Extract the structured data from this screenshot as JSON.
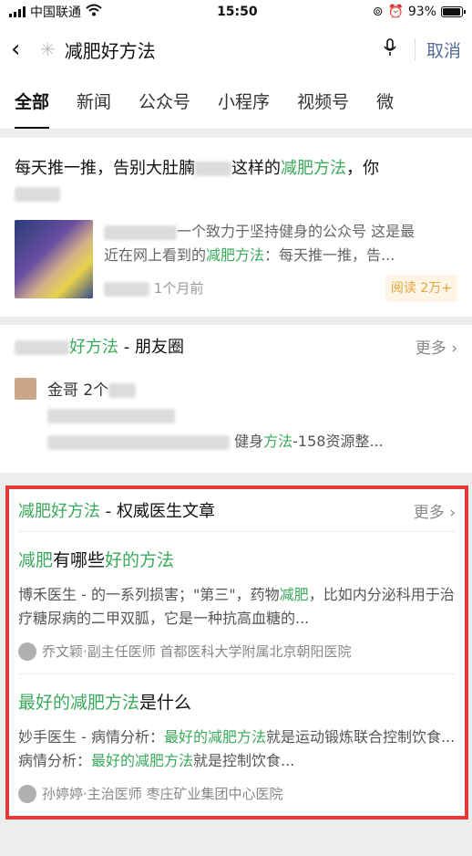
{
  "status": {
    "carrier": "中国联通",
    "time": "15:50",
    "battery": "93%",
    "battery_level": 0.93
  },
  "search": {
    "query": "减肥好方法",
    "cancel": "取消"
  },
  "tabs": [
    "全部",
    "新闻",
    "公众号",
    "小程序",
    "视频号",
    "微"
  ],
  "article": {
    "title_pre": "每天推一推，告别大肚腩",
    "title_mid": "这样的",
    "title_hl": "减肥方法",
    "title_post": "，你",
    "desc_pre": "一个致力于坚持健身的公众号 这是最",
    "desc_mid": "近在网上看到的",
    "desc_hl": "减肥方法",
    "desc_post": "：每天推一推，告...",
    "time": "1个月前",
    "reads": "阅读 2万+"
  },
  "moments": {
    "title_hl": "好方法",
    "title_post": " - 朋友圈",
    "more": "更多",
    "name": "金哥",
    "count": "2个",
    "link_pre": "健身",
    "link_hl": "方法",
    "link_post": "-158资源整..."
  },
  "doctor": {
    "title_hl": "减肥好方法",
    "title_post": " - 权威医生文章",
    "more": "更多",
    "items": [
      {
        "q_parts": [
          {
            "t": "减肥",
            "g": true
          },
          {
            "t": "有哪些",
            "g": false
          },
          {
            "t": "好的方法",
            "g": true
          }
        ],
        "snip_parts": [
          {
            "t": "博禾医生 - 的一系列损害；\"第三\"，药物",
            "g": false
          },
          {
            "t": "减肥",
            "g": true
          },
          {
            "t": "，比如内分泌科用于治疗糖尿病的二甲双胍，它是一种抗高血糖的...",
            "g": false
          }
        ],
        "author": "乔文颖·副主任医师  首都医科大学附属北京朝阳医院"
      },
      {
        "q_parts": [
          {
            "t": "最好的减肥方法",
            "g": true
          },
          {
            "t": "是什么",
            "g": false
          }
        ],
        "snip_parts": [
          {
            "t": "妙手医生 - 病情分析：",
            "g": false
          },
          {
            "t": "最好的减肥方法",
            "g": true
          },
          {
            "t": "就是运动锻炼联合控制饮食...病情分析：",
            "g": false
          },
          {
            "t": "最好的减肥方法",
            "g": true
          },
          {
            "t": "就是控制饮食...",
            "g": false
          }
        ],
        "author": "孙婷婷·主治医师  枣庄矿业集团中心医院"
      }
    ]
  }
}
